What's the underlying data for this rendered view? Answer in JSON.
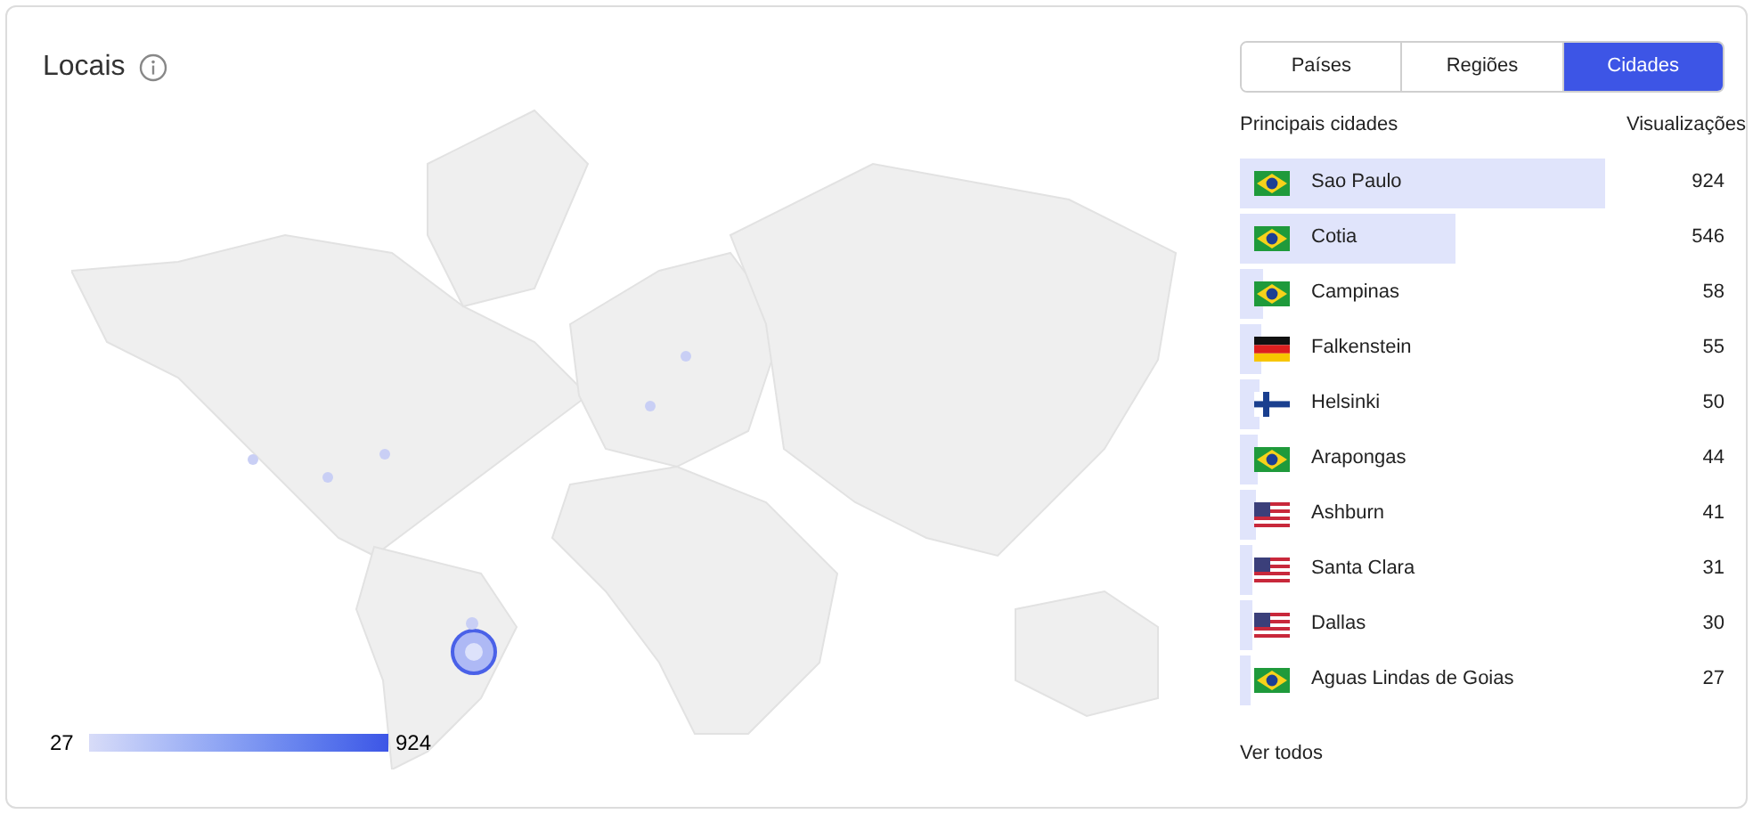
{
  "title": "Locais",
  "tabs": [
    {
      "label": "Países",
      "selected": false
    },
    {
      "label": "Regiões",
      "selected": false
    },
    {
      "label": "Cidades",
      "selected": true
    }
  ],
  "legend": {
    "min": "27",
    "max": "924"
  },
  "table": {
    "columns": [
      "Principais cidades",
      "Visualizações"
    ],
    "rows": [
      {
        "kind": "br",
        "city": "Sao Paulo",
        "views": "924"
      },
      {
        "kind": "br",
        "city": "Cotia",
        "views": "546"
      },
      {
        "kind": "br",
        "city": "Campinas",
        "views": "58"
      },
      {
        "kind": "de",
        "city": "Falkenstein",
        "views": "55"
      },
      {
        "kind": "fi",
        "city": "Helsinki",
        "views": "50"
      },
      {
        "kind": "br",
        "city": "Arapongas",
        "views": "44"
      },
      {
        "kind": "us",
        "city": "Ashburn",
        "views": "41"
      },
      {
        "kind": "us",
        "city": "Santa Clara",
        "views": "31"
      },
      {
        "kind": "us",
        "city": "Dallas",
        "views": "30"
      },
      {
        "kind": "br",
        "city": "Aguas Lindas de Goias",
        "views": "27"
      }
    ]
  },
  "footer_link": "Ver todos"
}
